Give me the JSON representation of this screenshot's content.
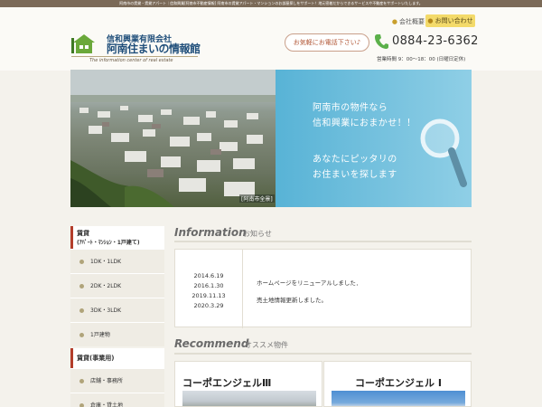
{
  "topbar": {
    "text": "阿南市の賃貸・賃貸アパート｜信和興業[阿南市不動産情報] 阿南市の賃貸アパート・マンションのお部屋探しをサポート！地元密着だからできるサービスや不動産をサポートいたします。"
  },
  "header": {
    "company_link": "会社概要",
    "contact_button": "お問い合わせ",
    "logo_company": "信和興業有限会社",
    "logo_title": "阿南住まいの情報館",
    "logo_tagline": "The information center of real estate",
    "call_prompt": "お気軽にお電話下さい♪",
    "phone": "0884-23-6362",
    "hours": "営業時間 9：00～18：00 (日曜日定休)"
  },
  "hero": {
    "line1": "阿南市の物件なら",
    "line2": "信和興業におまかせ！！",
    "line3": "あなたにピッタリの",
    "line4": "お住まいを探します",
    "photo_caption": "[阿南市全景]"
  },
  "sidebar": {
    "section1_title": "賃貸",
    "section1_sub": "(ｱﾊﾟｰﾄ・ﾏﾝｼｮﾝ・1戸建て)",
    "items1": [
      "1DK・1LDK",
      "2DK・2LDK",
      "3DK・3LDK",
      "1戸建物"
    ],
    "section2_title": "賃貸(事業用)",
    "items2": [
      "店舗・事務所",
      "倉庫・貸土地"
    ]
  },
  "information": {
    "title": "Information",
    "subtitle": "お知らせ",
    "dates": [
      "2014.6.19",
      "2016.1.30",
      "2019.11.13",
      "2020.3.29"
    ],
    "news": [
      "ホームページをリニューアルしました．",
      "売土地情報更新しました。"
    ]
  },
  "recommend": {
    "title": "Recommend",
    "subtitle": "オススメ物件",
    "cards": [
      {
        "name": "コーポエンジェルⅢ"
      },
      {
        "name": "コーポエンジェル I"
      }
    ]
  },
  "colors": {
    "accent_blue": "#58b3d6",
    "brand_navy": "#1f4e7a",
    "contact_yellow": "#f3da6a"
  }
}
